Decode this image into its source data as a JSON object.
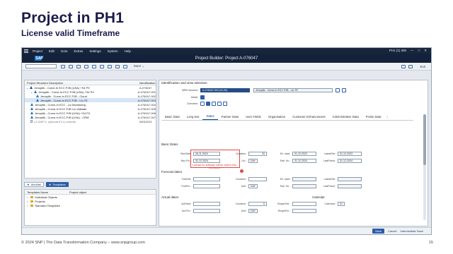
{
  "slide": {
    "title": "Project in PH1",
    "subtitle": "License valid Timeframe",
    "footer": "© 2024 SNP | The Data Transformation Company – www.snpgroup.com",
    "page_number": "15"
  },
  "menubar": {
    "items": [
      "Project",
      "Edit",
      "Goto",
      "Extras",
      "Settings",
      "System",
      "Help"
    ],
    "right": [
      "PH1 (1) 300",
      "—",
      "□",
      "✕"
    ]
  },
  "window": {
    "title": "Project Builder: Project A-076047",
    "logo": "SAP"
  },
  "toolbar": {
    "more_label": "More ⌄",
    "exit_label": "Exit"
  },
  "left_tree": {
    "col1": "Project Structure Description",
    "col2": "Identification",
    "rows": [
      {
        "label": "Jenoptik - Curve-In ECC PJB (USA) +S4 PX",
        "id": "A-076047"
      },
      {
        "label": "Jenoptik - Curve-In ECC PJB (USA) +S4 PX",
        "id": "A-076047-001"
      },
      {
        "label": "Jenoptik - Curve-In ECC PJB - Cloud",
        "id": "A-076047-002"
      },
      {
        "label": "Jenoptik - Curve-In ECC PJB - Lic.TE",
        "id": "A-076047-003"
      },
      {
        "label": "Jenoptik - Curve-In ECC - Lic.Monitoring",
        "id": "A-076047-004"
      },
      {
        "label": "Jenoptik - Curve-In ECC PJB Lic.Validate",
        "id": "A-076047-005"
      },
      {
        "label": "Jenoptik - Curve-In ECC PJB (USA) +S4 PX",
        "id": "A-076047-006"
      },
      {
        "label": "Jenoptik - Curve-In ECC PJB (USA) - CRM",
        "id": "A-076047-007"
      },
      {
        "label": "L2 DNP S, optional ECL) network",
        "id": "00012021"
      }
    ]
  },
  "left_buttons": {
    "worklist": "Worklist",
    "templates": "Templates"
  },
  "templates_pane": {
    "col1": "Templates Name",
    "col2": "Project object",
    "rows": [
      "Individual Objects",
      "Projects",
      "Standard Templates"
    ]
  },
  "identification": {
    "section_title": "Identification and view selection",
    "wbs_label": "WBS element:",
    "wbs_value": "A-076047-003 (01-00)",
    "wbs_desc": "Jenoptik - Curve-In ECC PJB - Lic.TE",
    "detail_label": "Detail:",
    "overview_label": "Overview:"
  },
  "tabs": [
    "Basic Data",
    "Long text",
    "Dates",
    "Partner Data",
    "User Fields",
    "Organisation",
    "Customer Enhancement",
    "Administrative Data",
    "Probe Data"
  ],
  "active_tab": "Dates",
  "basic_dates": {
    "title": "Basic Dates",
    "start_label": "BscStart:",
    "start_value": "26.11.2024",
    "duration_label": "Duration:",
    "duration_value": "20",
    "finish_label": "Bsc.Fin.:",
    "finish_value": "31.12.2024",
    "unit_label": "Un.:",
    "unit_value": "DAY",
    "erl_start_label": "Erl. start:",
    "erl_start_value": "01.12.2023",
    "latest_start_label": "LatestStrt:",
    "latest_start_value": "01.12.2023",
    "erl_fin_label": "Earl. fin.:",
    "erl_fin_value": "31.12.2024",
    "latest_fin_label": "LastFinish:",
    "latest_fin_value": "31.12.2024",
    "note": "License for software will be valid in this timeframe"
  },
  "forecast_dates": {
    "title": "Forecast dates",
    "start_label": "FcstStrt:",
    "finish_label": "FcstFin.:",
    "duration_label": "Duration:",
    "unit_label": "Unit:",
    "unit_value": "DAY",
    "erl_start_label": "Erl. start:",
    "erl_fin_label": "Earl. fin.:",
    "latest_start_label": "LatestStrt:",
    "latest_fin_label": "LastFinish:"
  },
  "actual_dates": {
    "title": "Actual dates",
    "start_label": "ActStart:",
    "finish_label": "Act.Fin.:",
    "duration_label": "Duration:",
    "duration_value": "0",
    "unit_label": "Unit:",
    "unit_value": "DAY",
    "resp_start_label": "RespbStrt.:",
    "resp_fin_label": "RespbFin.:",
    "calendar_title": "Calendar",
    "calendar_label": "Calendar:",
    "calendar_value": "01"
  },
  "statusbar": {
    "save": "Save",
    "cancel": "Cancel",
    "intermediate_save": "Intermediate Save"
  }
}
